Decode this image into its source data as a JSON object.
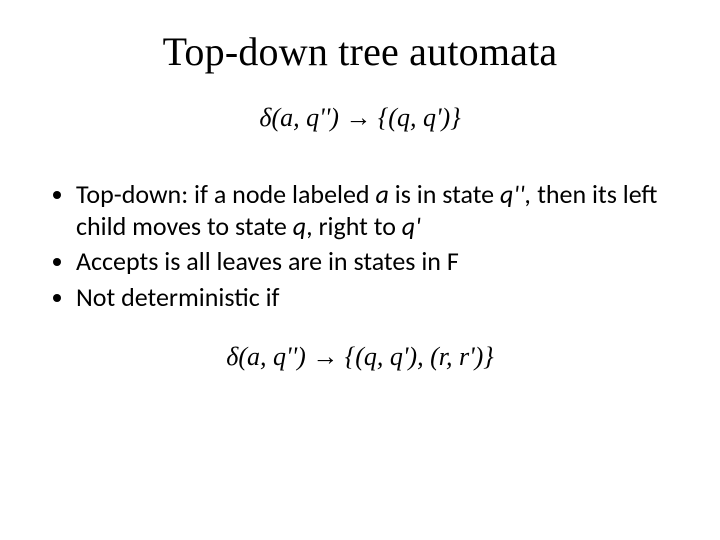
{
  "title": "Top-down tree automata",
  "formula1": "δ(a, q'') → {(q, q')}",
  "bullets": {
    "b1_pre": "Top-down: if a node labeled ",
    "b1_a": "a",
    "b1_mid1": " is in state ",
    "b1_q2": "q'', ",
    "b1_mid2": "then its left child moves to state ",
    "b1_q": "q",
    "b1_mid3": ", right to ",
    "b1_qp": "q'",
    "b2": "Accepts is all leaves are in states in F",
    "b3": "Not deterministic if"
  },
  "formula2": "δ(a, q'') → {(q, q'), (r, r')}"
}
